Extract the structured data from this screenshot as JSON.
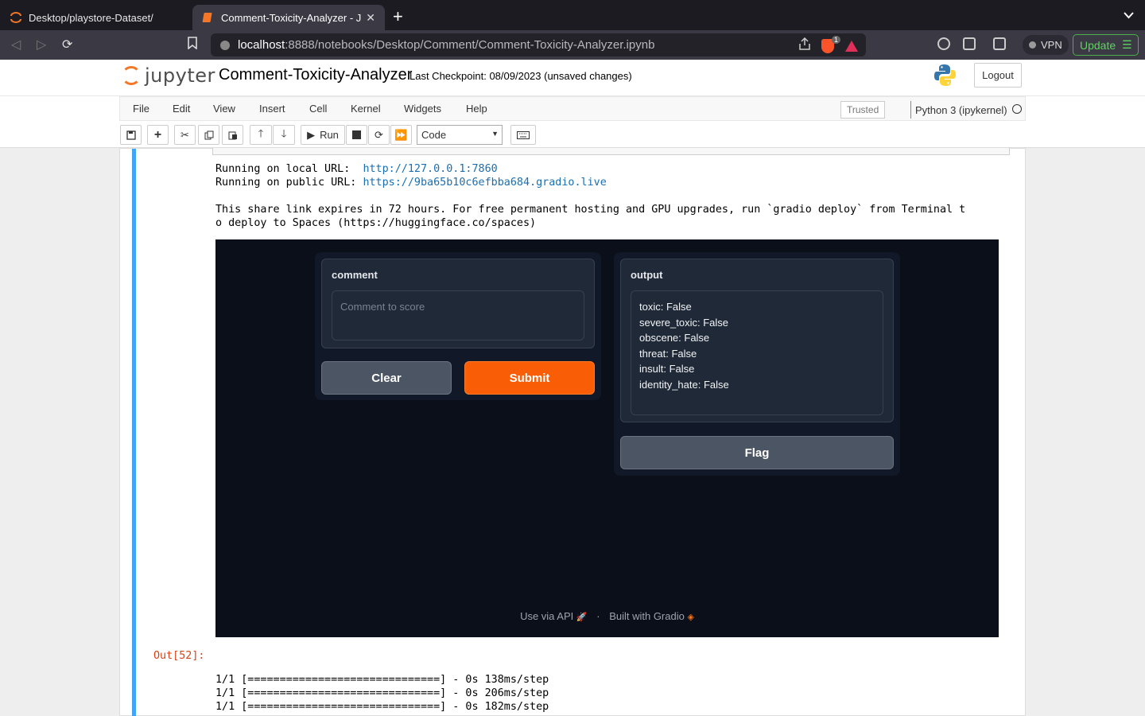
{
  "browser": {
    "tabs": [
      {
        "label": "Desktop/playstore-Dataset/",
        "active": false
      },
      {
        "label": "Comment-Toxicity-Analyzer - J",
        "active": true
      }
    ],
    "url_host": "localhost",
    "url_path": ":8888/notebooks/Desktop/Comment/Comment-Toxicity-Analyzer.ipynb",
    "shield_count": "1",
    "vpn_label": "VPN",
    "update_label": "Update"
  },
  "jupyter": {
    "logo_text": "jupyter",
    "notebook_title": "Comment-Toxicity-Analyzer",
    "checkpoint": "Last Checkpoint: 08/09/2023  (unsaved changes)",
    "logout_label": "Logout",
    "menu": [
      "File",
      "Edit",
      "View",
      "Insert",
      "Cell",
      "Kernel",
      "Widgets",
      "Help"
    ],
    "trusted_label": "Trusted",
    "kernel_name": "Python 3 (ipykernel)",
    "run_label": "Run",
    "cell_type": "Code"
  },
  "output": {
    "local_label": "Running on local URL:  ",
    "local_url": "http://127.0.0.1:7860",
    "public_label": "Running on public URL: ",
    "public_url": "https://9ba65b10c6efbba684.gradio.live",
    "share_line1": "This share link expires in 72 hours. For free permanent hosting and GPU upgrades, run `gradio deploy` from Terminal t",
    "share_line2": "o deploy to Spaces (https://huggingface.co/spaces)"
  },
  "gradio": {
    "input_label": "comment",
    "input_placeholder": "Comment to score",
    "output_label": "output",
    "output_lines": [
      "toxic: False",
      "severe_toxic: False",
      "obscene: False",
      "threat: False",
      "insult: False",
      "identity_hate: False"
    ],
    "clear_label": "Clear",
    "submit_label": "Submit",
    "flag_label": "Flag",
    "footer_api": "Use via API",
    "footer_sep": "·",
    "footer_built": "Built with Gradio"
  },
  "out_cell": {
    "prompt": "Out[52]:",
    "lines": [
      "1/1 [==============================] - 0s 138ms/step",
      "1/1 [==============================] - 0s 206ms/step",
      "1/1 [==============================] - 0s 182ms/step"
    ]
  },
  "colors": {
    "jupyter_orange": "#f37726",
    "gradio_primary": "#f95d06",
    "cell_selected_bar": "#42a5f5"
  }
}
